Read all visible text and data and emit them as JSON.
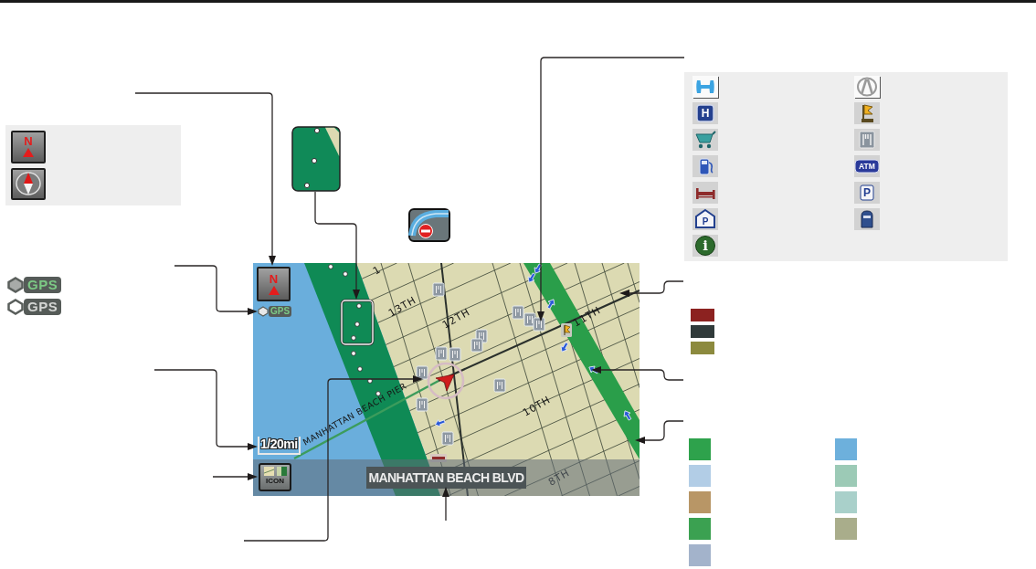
{
  "orientation_legend": [
    {
      "kind": "north_up",
      "label": "N"
    },
    {
      "kind": "heading_up"
    }
  ],
  "poi_legend": [
    {
      "kind": "h_emblem"
    },
    {
      "kind": "a_emblem"
    },
    {
      "kind": "hospital",
      "label": "H"
    },
    {
      "kind": "flag"
    },
    {
      "kind": "cart"
    },
    {
      "kind": "fork_knife"
    },
    {
      "kind": "fuel"
    },
    {
      "kind": "atm",
      "label": "ATM"
    },
    {
      "kind": "bed"
    },
    {
      "kind": "parking",
      "label": "P"
    },
    {
      "kind": "parking_garage",
      "label": "P"
    },
    {
      "kind": "mailbox"
    },
    {
      "kind": "info",
      "label": "i"
    }
  ],
  "gps_legend": [
    {
      "label": "GPS",
      "active": true
    },
    {
      "label": "GPS",
      "active": false
    }
  ],
  "map": {
    "north_button": {
      "label": "N"
    },
    "gps": {
      "label": "GPS",
      "active": true
    },
    "street_labels": [
      "1",
      "13TH",
      "12TH",
      "11TH",
      "10TH",
      "8TH"
    ],
    "pier_label": "MANHATTAN BEACH PIER",
    "scale": "1/20mi",
    "icon_button": "ICON",
    "current_street": "MANHATTAN BEACH BLVD"
  },
  "road_legend": [
    {
      "color": "#8c2220"
    },
    {
      "color": "#303a3a"
    },
    {
      "color": "#8c8a3e"
    }
  ],
  "area_legend": [
    {
      "color": "#2ea24c"
    },
    {
      "color": "#6db0dc"
    },
    {
      "color": "#b2cde6"
    },
    {
      "color": "#9ccab6"
    },
    {
      "color": "#b89666"
    },
    {
      "color": "#a9d0ca"
    },
    {
      "color": "#3ba151"
    },
    {
      "color": "#a9ad8b"
    },
    {
      "color": "#a3b3cb"
    }
  ]
}
